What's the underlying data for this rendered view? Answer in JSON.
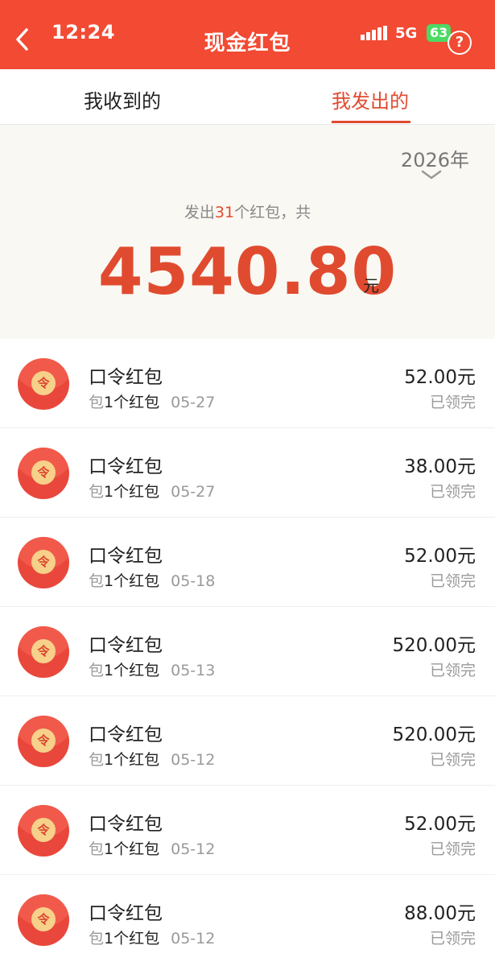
{
  "status_bar": {
    "time": "12:24",
    "network": "5G",
    "battery": "63"
  },
  "header": {
    "title": "现金红包",
    "back_icon": "back-chevron-icon",
    "help_icon": "help-icon",
    "help_glyph": "?"
  },
  "tabs": [
    {
      "label": "我收到的",
      "active": false
    },
    {
      "label": "我发出的",
      "active": true
    }
  ],
  "summary": {
    "year": "2026年",
    "count_prefix": "发出",
    "count": "31",
    "count_suffix": "个红包，共",
    "total": "4540.80",
    "unit": "元"
  },
  "list": {
    "items": [
      {
        "title": "口令红包",
        "meta_prefix": "包",
        "meta_count": "1个红包",
        "date": "05-27",
        "amount": "52.00元",
        "status": "已领完",
        "icon": "令"
      },
      {
        "title": "口令红包",
        "meta_prefix": "包",
        "meta_count": "1个红包",
        "date": "05-27",
        "amount": "38.00元",
        "status": "已领完",
        "icon": "令"
      },
      {
        "title": "口令红包",
        "meta_prefix": "包",
        "meta_count": "1个红包",
        "date": "05-18",
        "amount": "52.00元",
        "status": "已领完",
        "icon": "令"
      },
      {
        "title": "口令红包",
        "meta_prefix": "包",
        "meta_count": "1个红包",
        "date": "05-13",
        "amount": "520.00元",
        "status": "已领完",
        "icon": "令"
      },
      {
        "title": "口令红包",
        "meta_prefix": "包",
        "meta_count": "1个红包",
        "date": "05-12",
        "amount": "520.00元",
        "status": "已领完",
        "icon": "令"
      },
      {
        "title": "口令红包",
        "meta_prefix": "包",
        "meta_count": "1个红包",
        "date": "05-12",
        "amount": "52.00元",
        "status": "已领完",
        "icon": "令"
      },
      {
        "title": "口令红包",
        "meta_prefix": "包",
        "meta_count": "1个红包",
        "date": "05-12",
        "amount": "88.00元",
        "status": "已领完",
        "icon": "令"
      }
    ]
  },
  "colors": {
    "header_red": "#f24a33",
    "accent_red": "#e04b2f",
    "summary_bg": "#faf8f3",
    "envelope_red": "#e9473c",
    "seal_gold": "#f7d08a",
    "battery_green": "#4cd964"
  }
}
